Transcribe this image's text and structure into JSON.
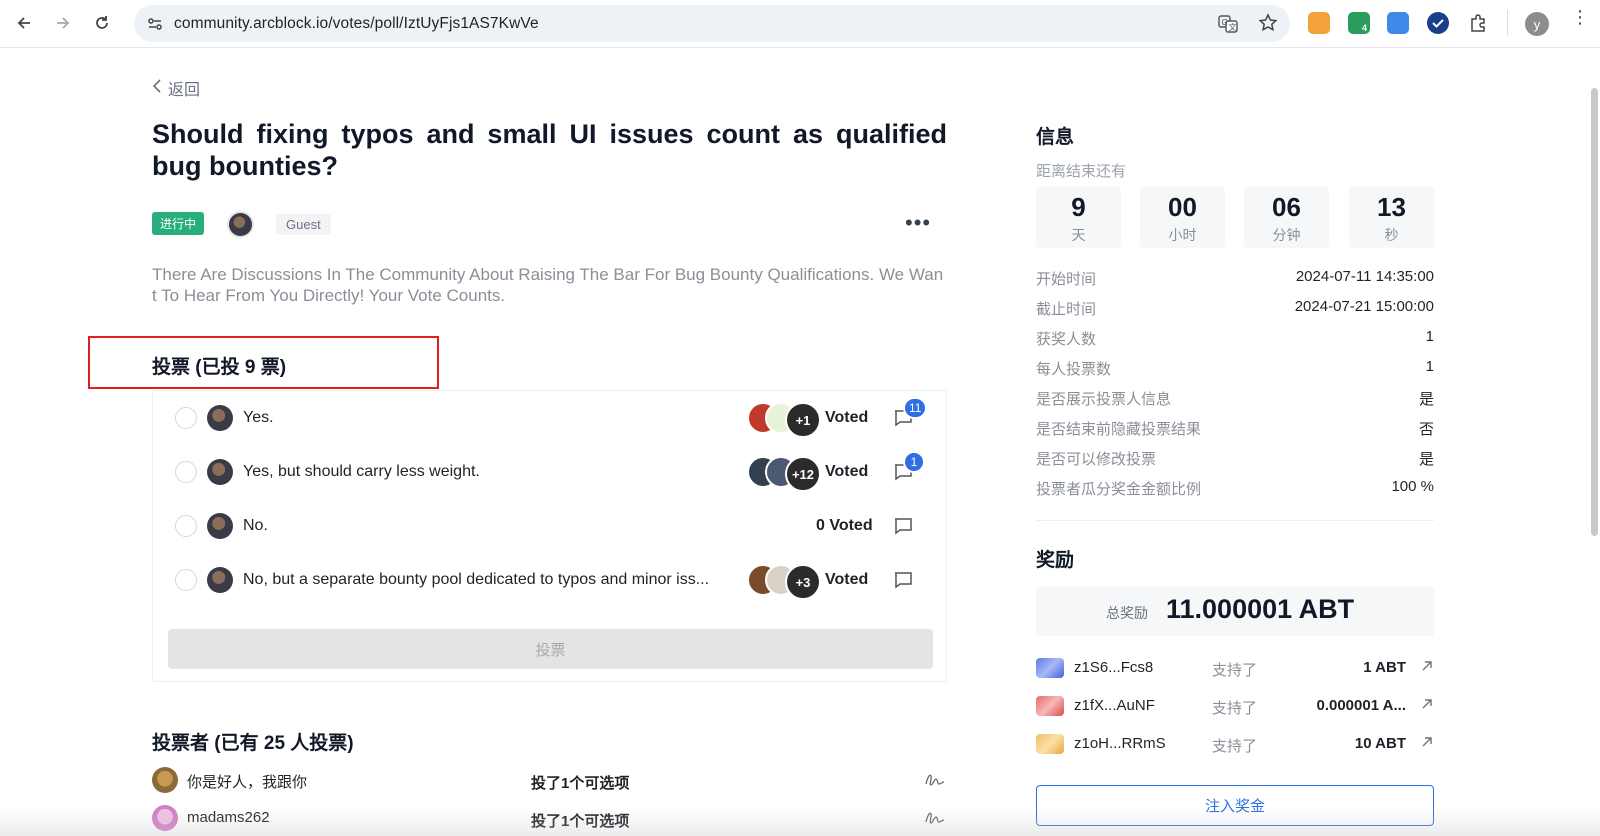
{
  "browser": {
    "url": "community.arcblock.io/votes/poll/IztUyFjs1AS7KwVe",
    "profile_initial": "y",
    "ext_badge": "4"
  },
  "page": {
    "back_label": "返回",
    "title": "Should fixing typos and small UI issues count as qualified bug bounties?",
    "status": "进行中",
    "author_role": "Guest",
    "more": "•••",
    "description": "There Are Discussions In The Community About Raising The Bar For Bug Bounty Qualifications. We Want To Hear From You Directly! Your Vote Counts."
  },
  "votes": {
    "title": "投票 (已投 9 票)",
    "options": [
      {
        "label": "Yes.",
        "extra": "+1",
        "voted": "Voted",
        "comments": "11"
      },
      {
        "label": "Yes, but should carry less weight.",
        "extra": "+12",
        "voted": "Voted",
        "comments": "1"
      },
      {
        "label": "No.",
        "extra": "",
        "voted": "0 Voted",
        "comments": ""
      },
      {
        "label": "No, but a separate bounty pool dedicated to typos and minor iss...",
        "extra": "+3",
        "voted": "Voted",
        "comments": ""
      }
    ],
    "submit_label": "投票"
  },
  "voters": {
    "title": "投票者 (已有 25 人投票)",
    "list": [
      {
        "name": "你是好人，我跟你",
        "choice": "投了1个可选项"
      },
      {
        "name": "madams262",
        "choice": "投了1个可选项"
      }
    ]
  },
  "info": {
    "title": "信息",
    "remaining_label": "距离结束还有",
    "countdown": [
      {
        "value": "9",
        "unit": "天"
      },
      {
        "value": "00",
        "unit": "小时"
      },
      {
        "value": "06",
        "unit": "分钟"
      },
      {
        "value": "13",
        "unit": "秒"
      }
    ],
    "rows": [
      {
        "k": "开始时间",
        "v": "2024-07-11 14:35:00"
      },
      {
        "k": "截止时间",
        "v": "2024-07-21 15:00:00"
      },
      {
        "k": "获奖人数",
        "v": "1"
      },
      {
        "k": "每人投票数",
        "v": "1"
      },
      {
        "k": "是否展示投票人信息",
        "v": "是"
      },
      {
        "k": "是否结束前隐藏投票结果",
        "v": "否"
      },
      {
        "k": "是否可以修改投票",
        "v": "是"
      },
      {
        "k": "投票者瓜分奖金金额比例",
        "v": "100 %"
      }
    ]
  },
  "rewards": {
    "title": "奖励",
    "total_label": "总奖励",
    "total_value": "11.000001 ABT",
    "list": [
      {
        "addr": "z1S6...Fcs8",
        "label": "支持了",
        "amount": "1 ABT"
      },
      {
        "addr": "z1fX...AuNF",
        "label": "支持了",
        "amount": "0.000001 A..."
      },
      {
        "addr": "z1oH...RRmS",
        "label": "支持了",
        "amount": "10 ABT"
      }
    ],
    "inject_label": "注入奖金"
  },
  "colors": {
    "status_green": "#27ae7a",
    "accent_blue": "#2f6fe4",
    "highlight_red": "#e02020"
  }
}
